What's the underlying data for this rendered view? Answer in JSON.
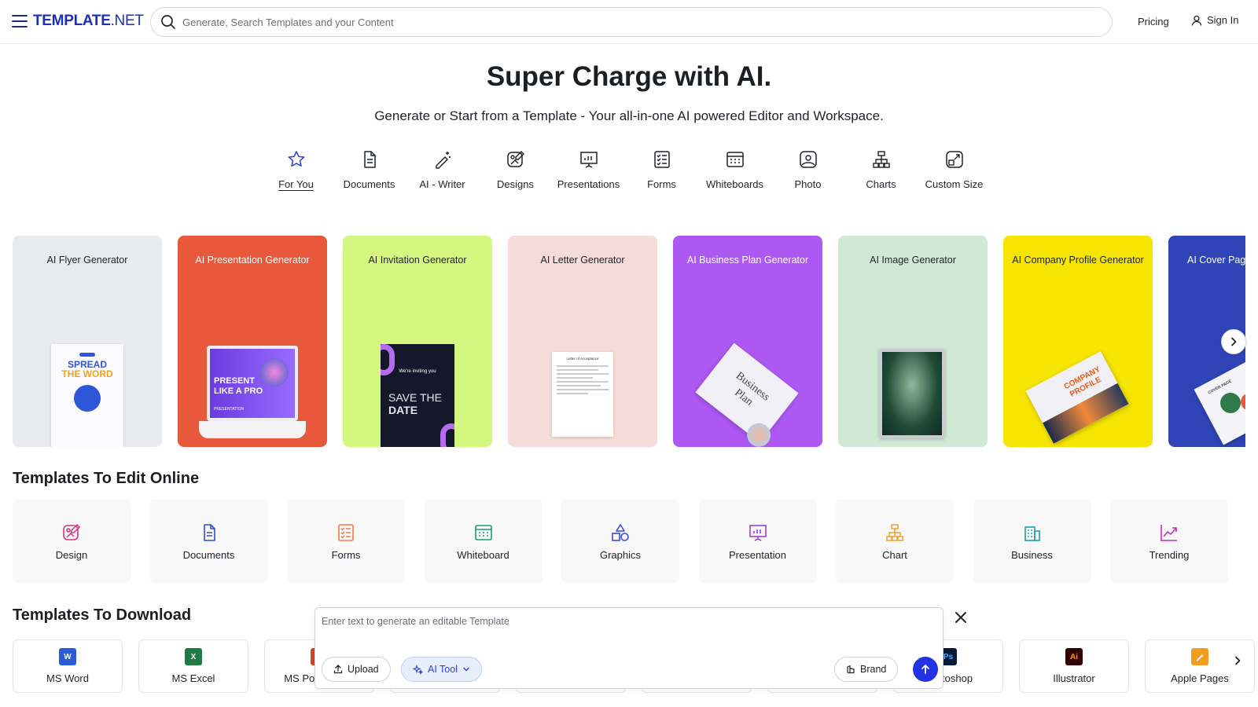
{
  "header": {
    "logo_main": "TEMPLATE",
    "logo_suffix": ".NET",
    "search_placeholder": "Generate, Search Templates and your Content",
    "pricing": "Pricing",
    "sign_in": "Sign In"
  },
  "hero": {
    "title": "Super Charge with AI.",
    "subtitle": "Generate or Start from a Template - Your all-in-one AI powered Editor and Workspace."
  },
  "categories": [
    {
      "label": "For You",
      "icon": "star-icon",
      "active": true
    },
    {
      "label": "Documents",
      "icon": "document-icon"
    },
    {
      "label": "AI - Writer",
      "icon": "magic-pen-icon"
    },
    {
      "label": "Designs",
      "icon": "design-icon"
    },
    {
      "label": "Presentations",
      "icon": "presentation-icon"
    },
    {
      "label": "Forms",
      "icon": "form-icon"
    },
    {
      "label": "Whiteboards",
      "icon": "whiteboard-icon"
    },
    {
      "label": "Photo",
      "icon": "photo-icon"
    },
    {
      "label": "Charts",
      "icon": "chart-icon"
    },
    {
      "label": "Custom Size",
      "icon": "custom-size-icon"
    }
  ],
  "ai_cards": [
    {
      "title": "AI Flyer Generator",
      "bg": "#e8eaee",
      "color": "#1f2328"
    },
    {
      "title": "AI Presentation Generator",
      "bg": "#e8583a",
      "color": "#ffffff"
    },
    {
      "title": "AI Invitation Generator",
      "bg": "#d4f77f",
      "color": "#1f2328"
    },
    {
      "title": "AI Letter Generator",
      "bg": "#f6dcd8",
      "color": "#1f2328"
    },
    {
      "title": "AI Business Plan Generator",
      "bg": "#ad58f2",
      "color": "#ffffff"
    },
    {
      "title": "AI Image Generator",
      "bg": "#d1e8d5",
      "color": "#1f2328"
    },
    {
      "title": "AI Company Profile Generator",
      "bg": "#f5e500",
      "color": "#1f2328"
    },
    {
      "title": "AI Cover Page",
      "bg": "#2f45b7",
      "color": "#ffffff"
    }
  ],
  "card_art": {
    "flyer_line1": "SPREAD",
    "flyer_line2": "THE WORD",
    "pres_line1": "PRESENT",
    "pres_line2": "LIKE A PRO",
    "pres_line3": "PRESENTATION",
    "invite_line1": "We're inviting you",
    "invite_line2": "SAVE THE",
    "invite_line3": "DATE",
    "letter_title": "Letter of Acceptance",
    "bp_line1": "Business",
    "bp_line2": "Plan",
    "cp_line1": "COMPANY",
    "cp_line2": "PROFILE",
    "cover_label": "COVER PAGE"
  },
  "edit_section": {
    "title": "Templates To Edit Online",
    "items": [
      {
        "label": "Design",
        "icon": "design-icon",
        "color": "#d63384"
      },
      {
        "label": "Documents",
        "icon": "document-icon",
        "color": "#2d4bd8"
      },
      {
        "label": "Forms",
        "icon": "form-icon",
        "color": "#f07a4a"
      },
      {
        "label": "Whiteboard",
        "icon": "whiteboard-icon",
        "color": "#1a9c6a"
      },
      {
        "label": "Graphics",
        "icon": "graphics-icon",
        "color": "#3b4bd8"
      },
      {
        "label": "Presentation",
        "icon": "presentation-icon",
        "color": "#a03fd8"
      },
      {
        "label": "Chart",
        "icon": "chart-icon",
        "color": "#f0a030"
      },
      {
        "label": "Business",
        "icon": "business-icon",
        "color": "#1aa3a3"
      },
      {
        "label": "Trending",
        "icon": "trending-icon",
        "color": "#c42fb8"
      }
    ]
  },
  "download_section": {
    "title": "Templates To Download",
    "items": [
      {
        "label": "MS Word",
        "badge": "W",
        "color": "#2b5cd6"
      },
      {
        "label": "MS Excel",
        "badge": "X",
        "color": "#1f7a45"
      },
      {
        "label": "MS PowerPoint",
        "badge": "P",
        "color": "#d24726"
      },
      {
        "label": "",
        "badge": "",
        "color": "#ffffff"
      },
      {
        "label": "",
        "badge": "",
        "color": "#ffffff"
      },
      {
        "label": "",
        "badge": "",
        "color": "#ffffff"
      },
      {
        "label": "",
        "badge": "",
        "color": "#ffffff"
      },
      {
        "label": "Photoshop",
        "badge": "Ps",
        "color": "#0a1a3a"
      },
      {
        "label": "Illustrator",
        "badge": "Ai",
        "color": "#330000"
      },
      {
        "label": "Apple Pages",
        "badge": "",
        "color": "#f39c1f"
      }
    ]
  },
  "generator": {
    "placeholder": "Enter text to generate an editable Template",
    "upload": "Upload",
    "ai_tool": "AI Tool",
    "brand": "Brand"
  }
}
